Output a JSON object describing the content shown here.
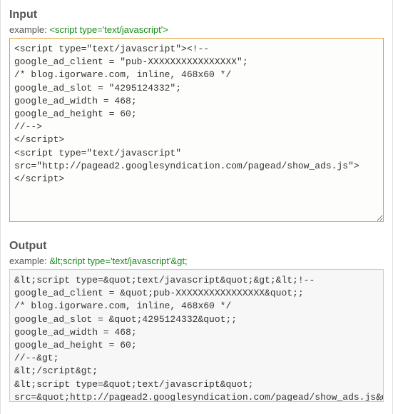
{
  "input": {
    "title": "Input",
    "example_label": "example:",
    "example_text": "<script type='text/javascript'>",
    "value": "<script type=\"text/javascript\"><!--\ngoogle_ad_client = \"pub-XXXXXXXXXXXXXXXX\";\n/* blog.igorware.com, inline, 468x60 */\ngoogle_ad_slot = \"4295124332\";\ngoogle_ad_width = 468;\ngoogle_ad_height = 60;\n//-->\n</script>\n<script type=\"text/javascript\"\nsrc=\"http://pagead2.googlesyndication.com/pagead/show_ads.js\">\n</script>"
  },
  "output": {
    "title": "Output",
    "example_label": "example:",
    "example_text": "&lt;script type='text/javascript'&gt;",
    "value": "&lt;script type=&quot;text/javascript&quot;&gt;&lt;!--\ngoogle_ad_client = &quot;pub-XXXXXXXXXXXXXXXX&quot;;\n/* blog.igorware.com, inline, 468x60 */\ngoogle_ad_slot = &quot;4295124332&quot;;\ngoogle_ad_width = 468;\ngoogle_ad_height = 60;\n//--&gt;\n&lt;/script&gt;\n&lt;script type=&quot;text/javascript&quot;\nsrc=&quot;http://pagead2.googlesyndication.com/pagead/show_ads.js&quot;&gt;\n&lt;/script&gt;"
  }
}
